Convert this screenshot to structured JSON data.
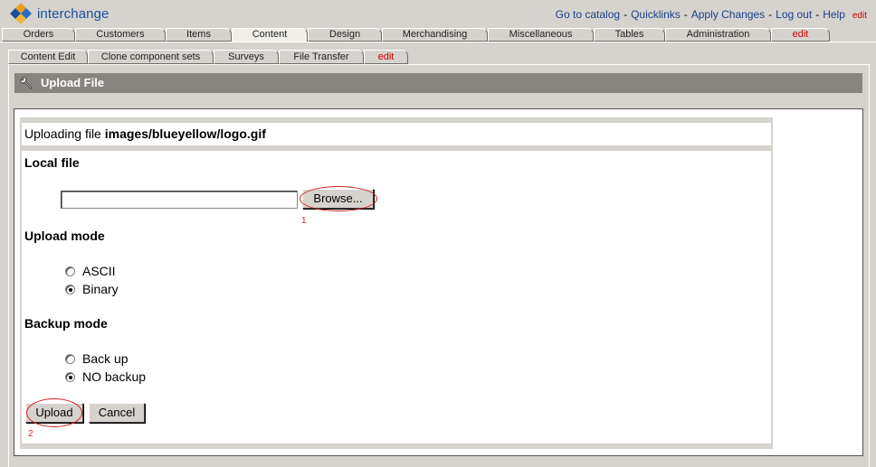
{
  "header": {
    "logo_text": "interchange",
    "links": [
      "Go to catalog",
      "Quicklinks",
      "Apply Changes",
      "Log out",
      "Help"
    ],
    "edit_label": "edit"
  },
  "main_tabs": [
    {
      "label": "Orders",
      "active": false
    },
    {
      "label": "Customers",
      "active": false
    },
    {
      "label": "Items",
      "active": false
    },
    {
      "label": "Content",
      "active": true
    },
    {
      "label": "Design",
      "active": false
    },
    {
      "label": "Merchandising",
      "active": false
    },
    {
      "label": "Miscellaneous",
      "active": false
    },
    {
      "label": "Tables",
      "active": false
    },
    {
      "label": "Administration",
      "active": false
    },
    {
      "label": "edit",
      "active": false
    }
  ],
  "sub_tabs": [
    "Content Edit",
    "Clone component sets",
    "Surveys",
    "File Transfer",
    "edit"
  ],
  "page_title": "Upload File",
  "form": {
    "uploading_prefix": "Uploading file",
    "uploading_file": "images/blueyellow/logo.gif",
    "local_file": {
      "title": "Local file",
      "value": "",
      "browse_label": "Browse..."
    },
    "upload_mode": {
      "title": "Upload mode",
      "options": [
        {
          "label": "ASCII",
          "checked": false
        },
        {
          "label": "Binary",
          "checked": true
        }
      ]
    },
    "backup_mode": {
      "title": "Backup mode",
      "options": [
        {
          "label": "Back up",
          "checked": false
        },
        {
          "label": "NO backup",
          "checked": true
        }
      ]
    },
    "upload_label": "Upload",
    "cancel_label": "Cancel"
  },
  "annotations": [
    "1",
    "2"
  ],
  "colors": {
    "link": "#1b3f8c",
    "edit": "#cc0000",
    "title_bar": "#888580",
    "annotation": "#d02020",
    "chrome": "#d6d3ce"
  }
}
